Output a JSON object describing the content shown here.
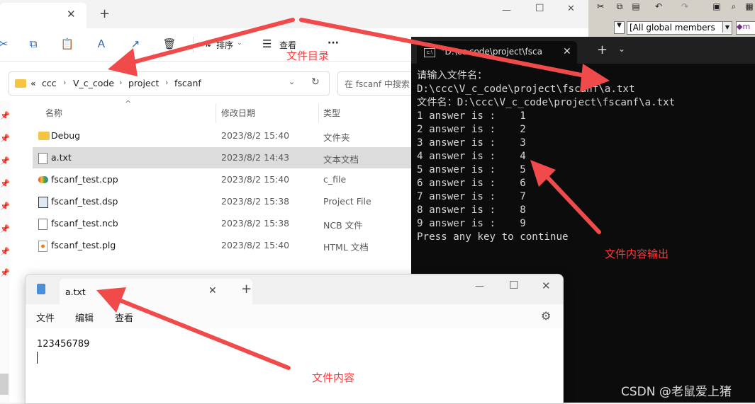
{
  "explorer": {
    "toolbar": {
      "sort_label": "排序",
      "view_label": "查看",
      "more_label": "···"
    },
    "breadcrumb": {
      "overflow": "«",
      "items": [
        "ccc",
        "V_c_code",
        "project",
        "fscanf"
      ]
    },
    "search_placeholder": "在 fscanf 中搜索",
    "columns": {
      "name": "名称",
      "modified": "修改日期",
      "type": "类型"
    },
    "files": [
      {
        "name": "Debug",
        "modified": "2023/8/2 15:40",
        "type": "文件夹",
        "icon": "folder-icon",
        "selected": false
      },
      {
        "name": "a.txt",
        "modified": "2023/8/2 14:43",
        "type": "文本文档",
        "icon": "text-file-icon",
        "selected": true
      },
      {
        "name": "fscanf_test.cpp",
        "modified": "2023/8/2 15:40",
        "type": "c_file",
        "icon": "cpp-file-icon",
        "selected": false
      },
      {
        "name": "fscanf_test.dsp",
        "modified": "2023/8/2 15:38",
        "type": "Project File",
        "icon": "project-file-icon",
        "selected": false
      },
      {
        "name": "fscanf_test.ncb",
        "modified": "2023/8/2 15:38",
        "type": "NCB 文件",
        "icon": "blank-file-icon",
        "selected": false
      },
      {
        "name": "fscanf_test.plg",
        "modified": "2023/8/2 15:40",
        "type": "HTML 文档",
        "icon": "html-file-icon",
        "selected": false
      }
    ]
  },
  "console": {
    "tab_title": "\"D:\\cc       code\\project\\fsca",
    "lines": [
      "请输入文件名：",
      "D:\\ccc\\V_c_code\\project\\fscanf\\a.txt",
      "文件名：D:\\ccc\\V_c_code\\project\\fscanf\\a.txt",
      "1 answer is :    1",
      "2 answer is :    2",
      "3 answer is :    3",
      "4 answer is :    4",
      "5 answer is :    5",
      "6 answer is :    6",
      "7 answer is :    7",
      "8 answer is :    8",
      "9 answer is :    9",
      "Press any key to continue"
    ]
  },
  "notepad": {
    "tab_title": "a.txt",
    "menu": [
      "文件",
      "编辑",
      "查看"
    ],
    "content": "123456789"
  },
  "ide": {
    "dropdown_label": "[All global members"
  },
  "annotations": {
    "dir_label": "文件目录",
    "output_label": "文件内容输出",
    "content_label": "文件内容",
    "watermark": "CSDN @老鼠爱上猪"
  },
  "colors": {
    "arrow": "#f04a4a",
    "annotation_text": "#ff3b3b",
    "selection": "#dcdcdc",
    "console_bg": "#0c0c0c"
  }
}
